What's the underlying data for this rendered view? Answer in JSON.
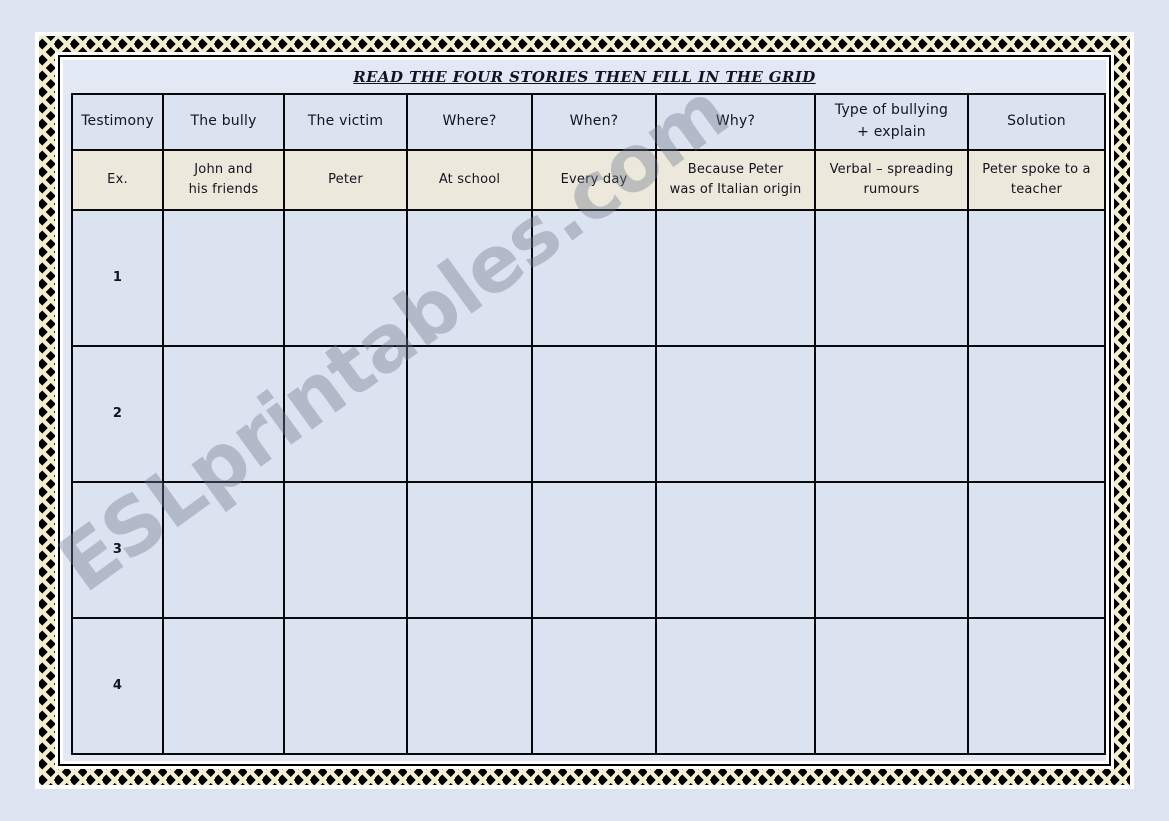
{
  "page": {
    "background_color": "#dfe4f2",
    "frame_band_color": "#000000",
    "frame_zigzag_color": "#f2eecd",
    "watermark": "ESLprintables.com"
  },
  "worksheet": {
    "title": "READ THE FOUR STORIES THEN FILL IN THE GRID",
    "table": {
      "header_bg": "#dbe2f0",
      "example_bg": "#ece8dc",
      "cell_bg": "#dbe2f0",
      "border_color": "#08080c",
      "columns": [
        "Testimony",
        "The bully",
        "The victim",
        "Where?",
        "When?",
        "Why?",
        "Type of bullying + explain",
        "Solution"
      ],
      "column_lines": [
        [
          "Testimony"
        ],
        [
          "The bully"
        ],
        [
          "The victim"
        ],
        [
          "Where?"
        ],
        [
          "When?"
        ],
        [
          "Why?"
        ],
        [
          "Type of bullying",
          "+ explain"
        ],
        [
          "Solution"
        ]
      ],
      "example_row": {
        "label": "Ex.",
        "cells": [
          [
            "Ex."
          ],
          [
            "John and",
            "his friends"
          ],
          [
            "Peter"
          ],
          [
            "At school"
          ],
          [
            "Every day"
          ],
          [
            "Because Peter",
            "was of Italian origin"
          ],
          [
            "Verbal – spreading",
            "rumours"
          ],
          [
            "Peter spoke to a",
            "teacher"
          ]
        ]
      },
      "blank_rows": [
        {
          "label": "1",
          "cells": [
            "1",
            "",
            "",
            "",
            "",
            "",
            "",
            ""
          ]
        },
        {
          "label": "2",
          "cells": [
            "2",
            "",
            "",
            "",
            "",
            "",
            "",
            ""
          ]
        },
        {
          "label": "3",
          "cells": [
            "3",
            "",
            "",
            "",
            "",
            "",
            "",
            ""
          ]
        },
        {
          "label": "4",
          "cells": [
            "4",
            "",
            "",
            "",
            "",
            "",
            "",
            ""
          ]
        }
      ]
    }
  }
}
